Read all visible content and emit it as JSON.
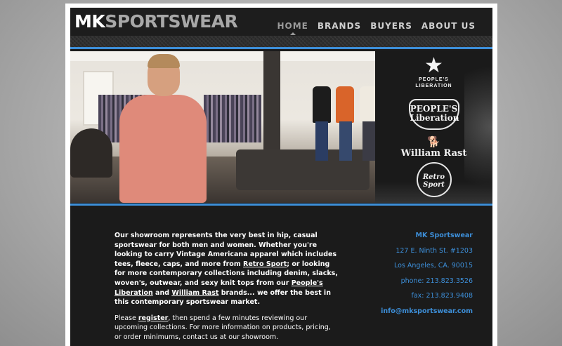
{
  "header": {
    "logo_mk": "MK",
    "logo_sportswear": "SPORTSWEAR",
    "nav": [
      {
        "label": "HOME",
        "active": true
      },
      {
        "label": "BRANDS",
        "active": false
      },
      {
        "label": "BUYERS",
        "active": false
      },
      {
        "label": "ABOUT US",
        "active": false
      }
    ]
  },
  "brands": {
    "star_label_1": "PEOPLE'S",
    "star_label_2": "LIBERATION",
    "shield_line_1": "PEOPLE'S",
    "shield_line_2": "Liberation",
    "william_rast": "William Rast",
    "retro_line_1": "Retro",
    "retro_line_2": "Sport"
  },
  "about": {
    "p1_a": "Our showroom represents the very best in hip, casual sportswear for both men and women. Whether you're looking to carry Vintage Americana apparel which includes tees, fleece, caps, and more from ",
    "link_retro": "Retro Sport",
    "p1_b": "; or looking for more contemporary collections including denim, slacks, woven's, outwear, and sexy knit tops from our ",
    "link_peoples": "People's Liberation",
    "p1_c": " and ",
    "link_william": "William Rast",
    "p1_d": " brands... we offer the best in this contemporary sportswear market.",
    "p2_a": "Please ",
    "link_register": "register",
    "p2_b": ", then spend a few minutes reviewing our upcoming collections. For more information on products, pricing, or order minimums, contact us at our showroom."
  },
  "contact": {
    "company": "MK Sportswear",
    "street": "127 E. Ninth St. #1203",
    "city": "Los Angeles, CA. 90015",
    "phone": "phone: 213.823.3526",
    "fax": "fax: 213.823.9408",
    "email": "info@mksportswear.com"
  },
  "colors": {
    "accent": "#3d8fd9",
    "background": "#1b1b1b",
    "nav_text": "#cfcfcf"
  }
}
